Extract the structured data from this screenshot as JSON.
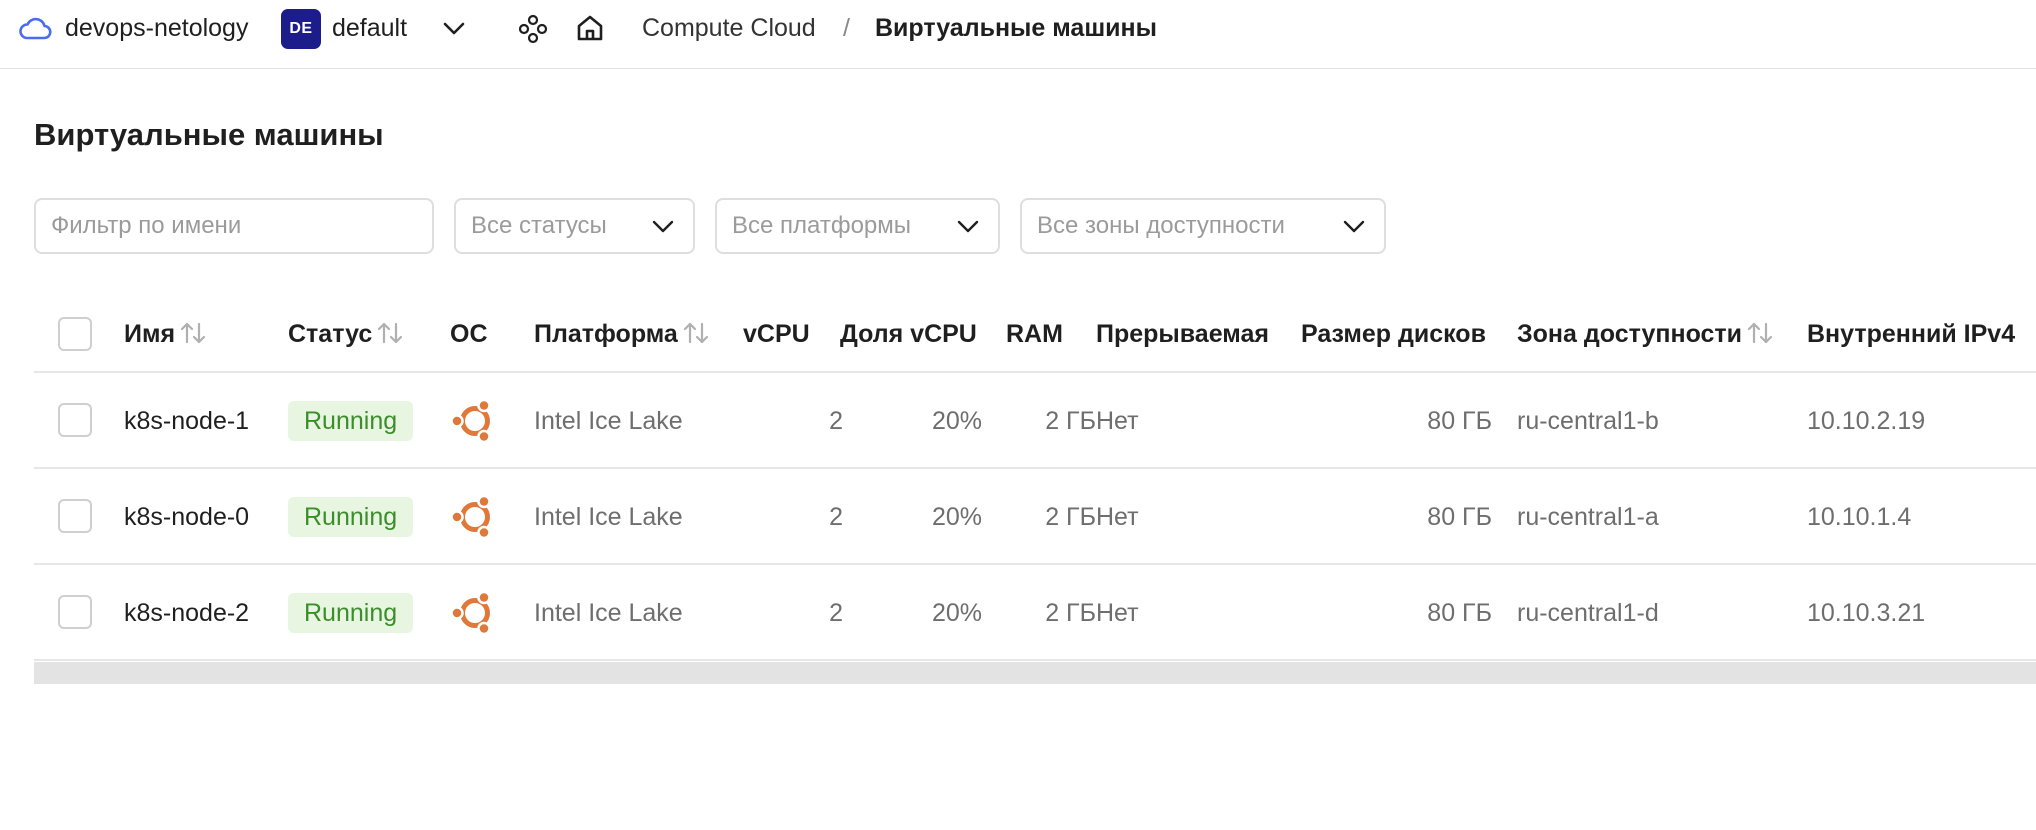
{
  "topbar": {
    "cloud_name": "devops-netology",
    "folder_badge": "DE",
    "folder_name": "default",
    "breadcrumb_service": "Compute Cloud",
    "breadcrumb_separator": "/",
    "breadcrumb_current": "Виртуальные машины",
    "icons": [
      "cloud-icon",
      "chevron-down-icon",
      "services-icon",
      "home-icon"
    ]
  },
  "page": {
    "title": "Виртуальные машины"
  },
  "filters": {
    "name_placeholder": "Фильтр по имени",
    "status_value": "Все статусы",
    "platform_value": "Все платформы",
    "zone_value": "Все зоны доступности"
  },
  "table": {
    "columns": [
      "Имя",
      "Статус",
      "ОС",
      "Платформа",
      "vCPU",
      "Доля vCPU",
      "RAM",
      "Прерываемая",
      "Размер дисков",
      "Зона доступности",
      "Внутренний IPv4"
    ],
    "rows": [
      {
        "name": "k8s-node-1",
        "status": "Running",
        "os": "ubuntu-icon",
        "platform": "Intel Ice Lake",
        "vcpu": "2",
        "vcpu_share": "20%",
        "ram": "2 ГБ",
        "preemptible": "Нет",
        "disk": "80 ГБ",
        "zone": "ru-central1-b",
        "ipv4": "10.10.2.19"
      },
      {
        "name": "k8s-node-0",
        "status": "Running",
        "os": "ubuntu-icon",
        "platform": "Intel Ice Lake",
        "vcpu": "2",
        "vcpu_share": "20%",
        "ram": "2 ГБ",
        "preemptible": "Нет",
        "disk": "80 ГБ",
        "zone": "ru-central1-a",
        "ipv4": "10.10.1.4"
      },
      {
        "name": "k8s-node-2",
        "status": "Running",
        "os": "ubuntu-icon",
        "platform": "Intel Ice Lake",
        "vcpu": "2",
        "vcpu_share": "20%",
        "ram": "2 ГБ",
        "preemptible": "Нет",
        "disk": "80 ГБ",
        "zone": "ru-central1-d",
        "ipv4": "10.10.3.21"
      }
    ]
  },
  "colors": {
    "accent_badge": "#1c1c8a",
    "status_running_bg": "#e7f5e1",
    "status_running_text": "#3a8f2a",
    "ubuntu_orange": "#e0783a"
  }
}
